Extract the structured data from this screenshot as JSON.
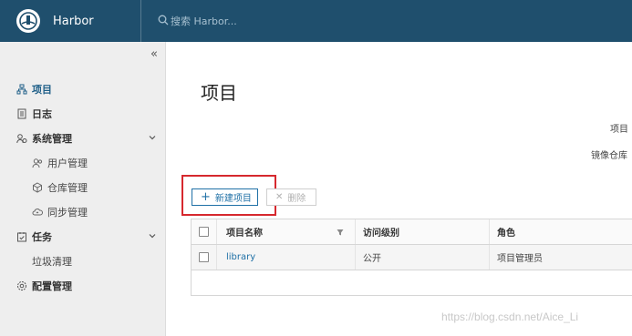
{
  "app": {
    "name": "Harbor"
  },
  "search": {
    "placeholder": "搜索 Harbor..."
  },
  "sidebar": {
    "items": [
      {
        "label": "项目"
      },
      {
        "label": "日志"
      },
      {
        "label": "系统管理"
      },
      {
        "label": "用户管理"
      },
      {
        "label": "仓库管理"
      },
      {
        "label": "同步管理"
      },
      {
        "label": "任务"
      },
      {
        "label": "垃圾清理"
      },
      {
        "label": "配置管理"
      }
    ]
  },
  "main": {
    "title": "项目",
    "stat_projects_label": "项目",
    "stat_repos_label": "镜像仓库",
    "new_project_button": "新建项目",
    "delete_button": "删除",
    "table": {
      "columns": [
        "项目名称",
        "访问级别",
        "角色"
      ],
      "rows": [
        {
          "name": "library",
          "access": "公开",
          "role": "项目管理员"
        }
      ]
    }
  },
  "watermark": "https://blog.csdn.net/Aice_Li",
  "colors": {
    "header": "#1f4f6d",
    "sidebar": "#eeeeee",
    "link": "#1f70a6",
    "highlight_box": "#d6282e"
  },
  "icons": [
    "harbor-logo-icon",
    "search-icon",
    "collapse-icon",
    "project-icon",
    "log-icon",
    "admin-icon",
    "user-icon",
    "registry-icon",
    "replication-icon",
    "task-icon",
    "config-icon",
    "chevron-down-icon",
    "filter-icon",
    "plus-icon",
    "close-icon"
  ]
}
